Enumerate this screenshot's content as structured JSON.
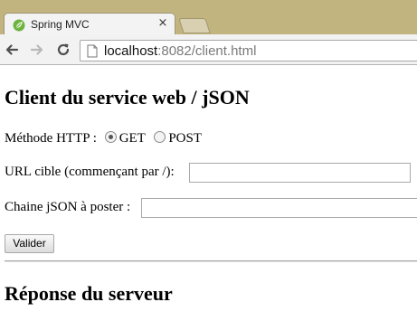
{
  "browser": {
    "tab_title": "Spring MVC",
    "tab_close": "×",
    "url_host": "localhost",
    "url_rest": ":8082/client.html"
  },
  "page": {
    "title": "Client du service web / jSON",
    "method_label": "Méthode HTTP :",
    "method_options": [
      {
        "label": "GET",
        "selected": true
      },
      {
        "label": "POST",
        "selected": false
      }
    ],
    "url_label": "URL cible (commençant par /):",
    "url_value": "",
    "json_label": "Chaine jSON à poster :",
    "json_value": "",
    "submit_label": "Valider",
    "response_title": "Réponse du serveur"
  },
  "colors": {
    "tabstrip": "#c2b47f",
    "spring_leaf": "#6db33f"
  }
}
